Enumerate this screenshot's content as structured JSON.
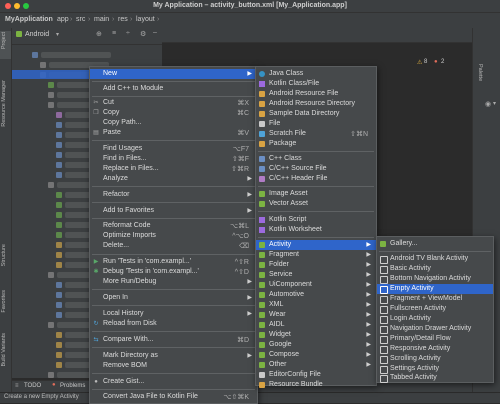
{
  "window": {
    "title": "My Application – activity_button.xml [My_Application.app]"
  },
  "breadcrumb": [
    "MyApplication",
    "app",
    "src",
    "main",
    "res",
    "layout"
  ],
  "project_panel": {
    "view_label": "Android"
  },
  "left_stripe": {
    "project": "Project",
    "resource_manager": "Resource Manager",
    "structure": "Structure",
    "favorites": "Favorites",
    "build_variants": "Build Variants"
  },
  "right_stripe": {
    "palette": "Palette"
  },
  "editor": {
    "warnings": "8",
    "errors": "2"
  },
  "bottom_tools": {
    "todo": "TODO",
    "problems": "Problems"
  },
  "status": {
    "text": "Create a new Empty Activity"
  },
  "context_menu": {
    "items": [
      {
        "label": "New"
      },
      {
        "label": "Add C++ to Module"
      },
      {
        "label": "Cut",
        "shortcut": "⌘X"
      },
      {
        "label": "Copy",
        "shortcut": "⌘C"
      },
      {
        "label": "Copy Path..."
      },
      {
        "label": "Paste",
        "shortcut": "⌘V"
      },
      {
        "label": "Find Usages",
        "shortcut": "⌥F7"
      },
      {
        "label": "Find in Files...",
        "shortcut": "⇧⌘F"
      },
      {
        "label": "Replace in Files...",
        "shortcut": "⇧⌘R"
      },
      {
        "label": "Analyze"
      },
      {
        "label": "Refactor"
      },
      {
        "label": "Add to Favorites"
      },
      {
        "label": "Reformat Code",
        "shortcut": "⌥⌘L"
      },
      {
        "label": "Optimize Imports",
        "shortcut": "^⌥O"
      },
      {
        "label": "Delete...",
        "shortcut": "⌫"
      },
      {
        "label": "Run 'Tests in 'com.exampl...'",
        "shortcut": "^⇧R"
      },
      {
        "label": "Debug 'Tests in 'com.exampl...'",
        "shortcut": "^⇧D"
      },
      {
        "label": "More Run/Debug"
      },
      {
        "label": "Open In"
      },
      {
        "label": "Local History"
      },
      {
        "label": "Reload from Disk"
      },
      {
        "label": "Compare With...",
        "shortcut": "⌘D"
      },
      {
        "label": "Mark Directory as"
      },
      {
        "label": "Remove BOM"
      },
      {
        "label": "Create Gist..."
      },
      {
        "label": "Convert Java File to Kotlin File",
        "shortcut": "⌥⇧⌘K"
      }
    ]
  },
  "new_menu": {
    "items": [
      {
        "label": "Java Class"
      },
      {
        "label": "Kotlin Class/File"
      },
      {
        "label": "Android Resource File"
      },
      {
        "label": "Android Resource Directory"
      },
      {
        "label": "Sample Data Directory"
      },
      {
        "label": "File"
      },
      {
        "label": "Scratch File",
        "shortcut": "⇧⌘N"
      },
      {
        "label": "Package"
      },
      {
        "label": "C++ Class"
      },
      {
        "label": "C/C++ Source File"
      },
      {
        "label": "C/C++ Header File"
      },
      {
        "label": "Image Asset"
      },
      {
        "label": "Vector Asset"
      },
      {
        "label": "Kotlin Script"
      },
      {
        "label": "Kotlin Worksheet"
      },
      {
        "label": "Activity"
      },
      {
        "label": "Fragment"
      },
      {
        "label": "Folder"
      },
      {
        "label": "Service"
      },
      {
        "label": "UiComponent"
      },
      {
        "label": "Automotive"
      },
      {
        "label": "XML"
      },
      {
        "label": "Wear"
      },
      {
        "label": "AIDL"
      },
      {
        "label": "Widget"
      },
      {
        "label": "Google"
      },
      {
        "label": "Compose"
      },
      {
        "label": "Other"
      },
      {
        "label": "EditorConfig File"
      },
      {
        "label": "Resource Bundle"
      }
    ]
  },
  "activity_menu": {
    "items": [
      {
        "label": "Gallery..."
      },
      {
        "label": "Android TV Blank Activity"
      },
      {
        "label": "Basic Activity"
      },
      {
        "label": "Bottom Navigation Activity"
      },
      {
        "label": "Empty Activity"
      },
      {
        "label": "Fragment + ViewModel"
      },
      {
        "label": "Fullscreen Activity"
      },
      {
        "label": "Login Activity"
      },
      {
        "label": "Navigation Drawer Activity"
      },
      {
        "label": "Primary/Detail Flow"
      },
      {
        "label": "Responsive Activity"
      },
      {
        "label": "Scrolling Activity"
      },
      {
        "label": "Settings Activity"
      },
      {
        "label": "Tabbed Activity"
      }
    ]
  },
  "colors": {
    "selection": "#2f65ca",
    "menu_bg": "#46494b",
    "android_green": "#7cb342",
    "kotlin": "#9c6ade"
  }
}
